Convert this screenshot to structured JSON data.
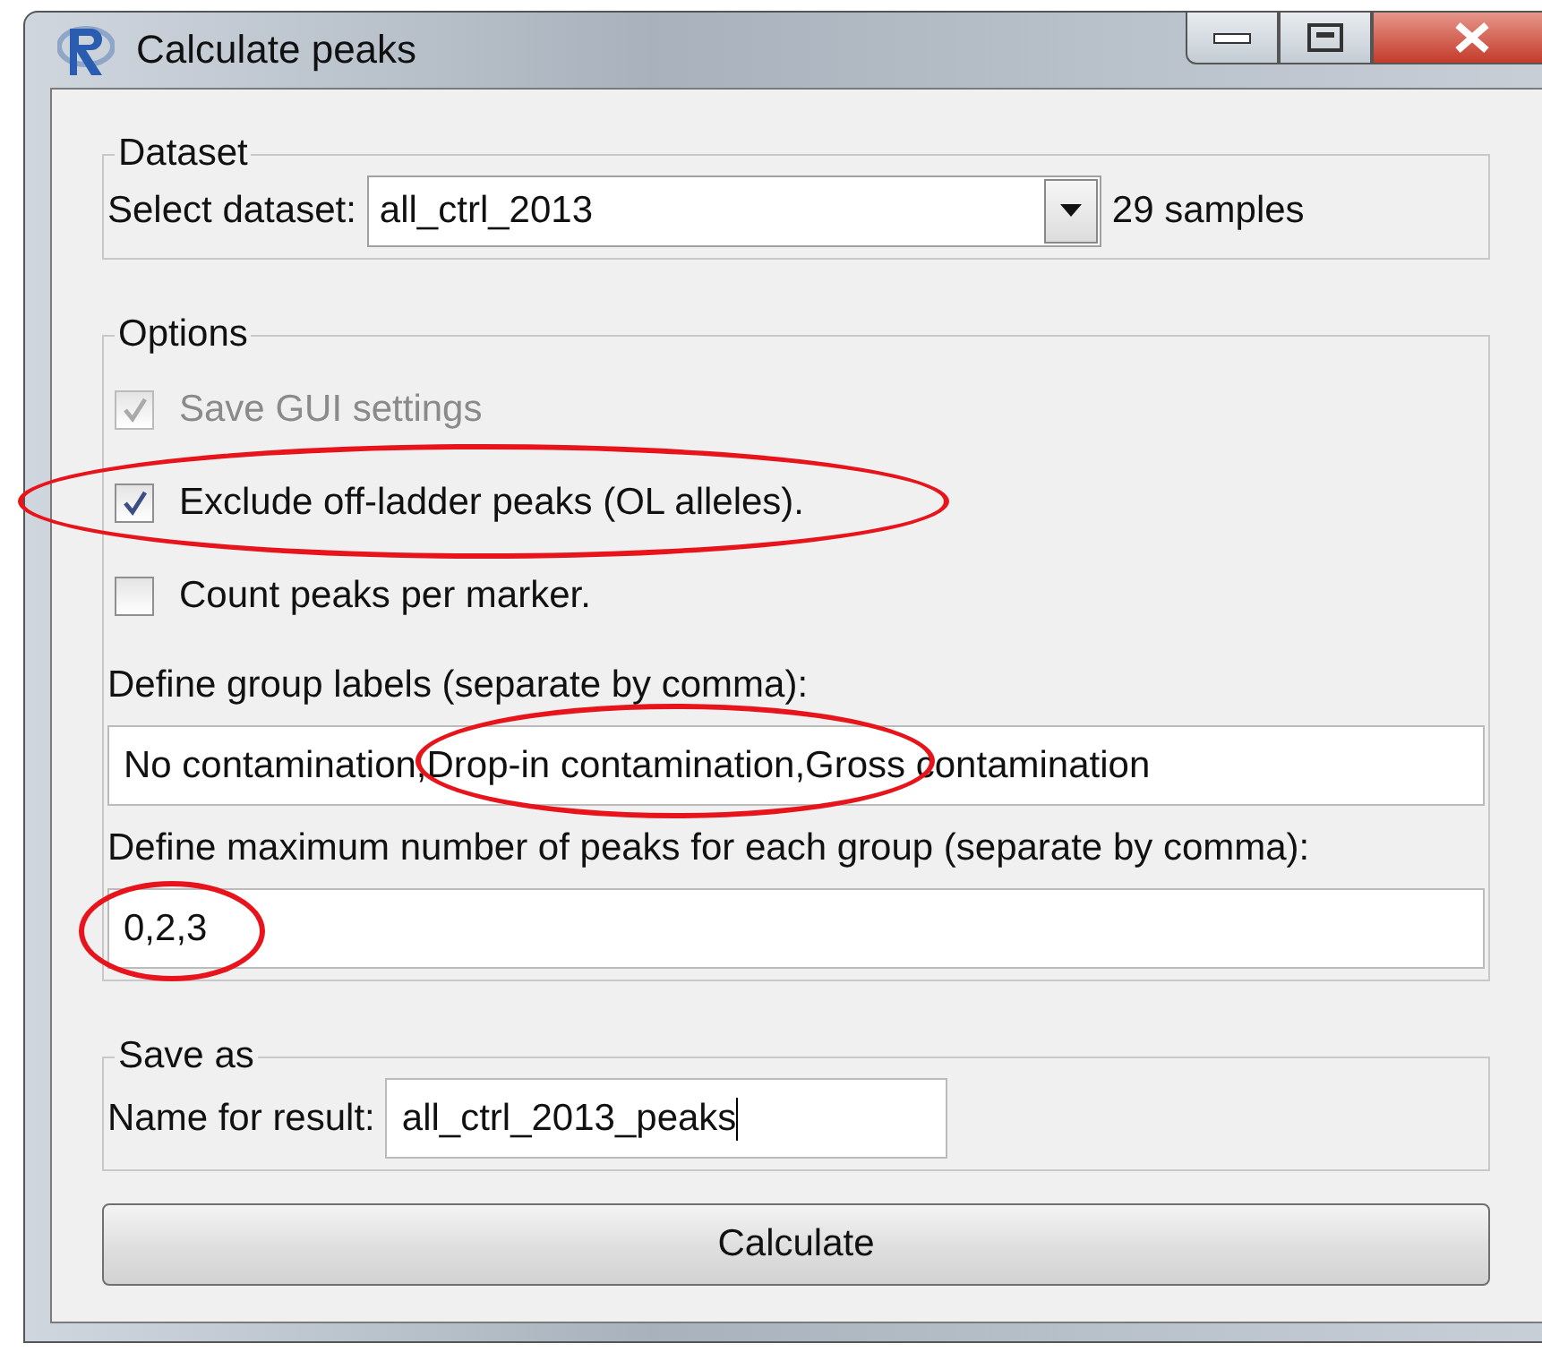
{
  "window": {
    "title": "Calculate peaks"
  },
  "dataset": {
    "legend": "Dataset",
    "label": "Select dataset:",
    "value": "all_ctrl_2013",
    "count": "29 samples"
  },
  "options": {
    "legend": "Options",
    "checkboxes": [
      {
        "label": "Save GUI settings",
        "checked": true,
        "disabled": true,
        "circled": false
      },
      {
        "label": "Exclude off-ladder peaks (OL alleles).",
        "checked": true,
        "disabled": false,
        "circled": true
      },
      {
        "label": "Count peaks per marker.",
        "checked": false,
        "disabled": false,
        "circled": false
      }
    ],
    "group_labels": {
      "label": "Define group labels (separate by comma):",
      "value": "No contamination,Drop-in contamination,Gross contamination",
      "circled": true
    },
    "max_peaks": {
      "label": "Define maximum number of peaks for each group (separate by comma):",
      "value": "0,2,3",
      "circled": true
    }
  },
  "save_as": {
    "legend": "Save as",
    "label": "Name for result:",
    "value": "all_ctrl_2013_peaks",
    "focused": true
  },
  "buttons": [
    "Calculate"
  ]
}
